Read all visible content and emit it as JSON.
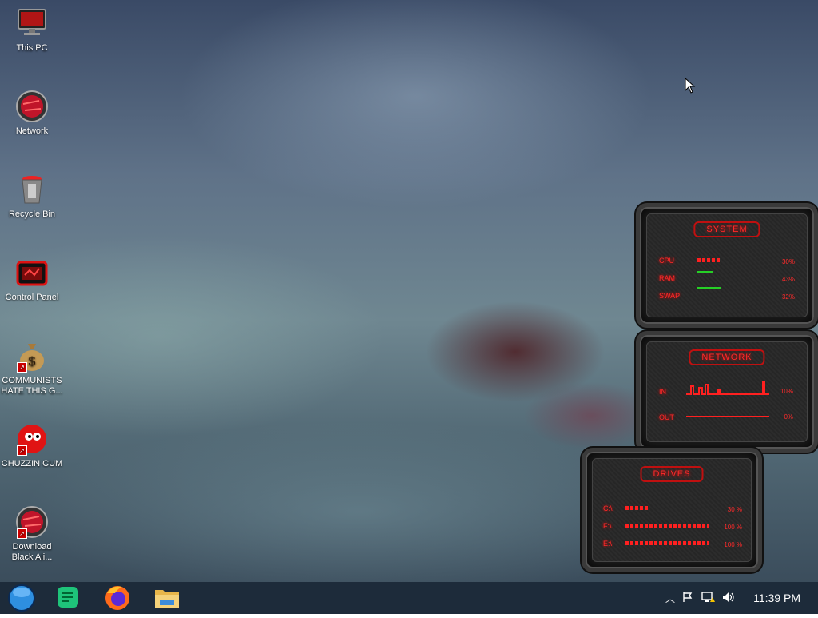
{
  "desktop_icons": [
    {
      "label": "This PC",
      "icon": "monitor-icon"
    },
    {
      "label": "Network",
      "icon": "network-globe-icon"
    },
    {
      "label": "Recycle Bin",
      "icon": "recycle-bin-icon"
    },
    {
      "label": "Control Panel",
      "icon": "control-panel-icon"
    },
    {
      "label": "COMMUNISTS HATE THIS G...",
      "icon": "money-bag-icon"
    },
    {
      "label": "CHUZZIN CUM",
      "icon": "red-chuzzle-icon"
    },
    {
      "label": "Download Black Ali...",
      "icon": "network-globe-icon"
    }
  ],
  "system_gadget": {
    "title": "SYSTEM",
    "rows": [
      {
        "label": "CPU",
        "value": "30%",
        "level": 0.3
      },
      {
        "label": "RAM",
        "value": "43%",
        "level": 0.43
      },
      {
        "label": "SWAP",
        "value": "32%",
        "level": 0.32
      }
    ]
  },
  "network_gadget": {
    "title": "NETWORK",
    "rows": [
      {
        "label": "IN",
        "value": "10%"
      },
      {
        "label": "OUT",
        "value": "0%"
      }
    ]
  },
  "drives_gadget": {
    "title": "DRIVES",
    "rows": [
      {
        "label": "C:\\",
        "value": "30 %",
        "level": 0.3
      },
      {
        "label": "F:\\",
        "value": "100 %",
        "level": 1.0
      },
      {
        "label": "E:\\",
        "value": "100 %",
        "level": 1.0
      }
    ]
  },
  "taskbar": {
    "start_icon": "start-orb-icon",
    "pinned": [
      "notes-app-icon",
      "firefox-icon",
      "file-explorer-icon"
    ],
    "tray_icons": [
      "chevron-up-icon",
      "action-center-flag-icon",
      "network-warning-icon",
      "speaker-icon"
    ],
    "clock": "11:39 PM"
  },
  "colors": {
    "accent": "#ff2a2a",
    "taskbar": "#1d2b3a"
  }
}
